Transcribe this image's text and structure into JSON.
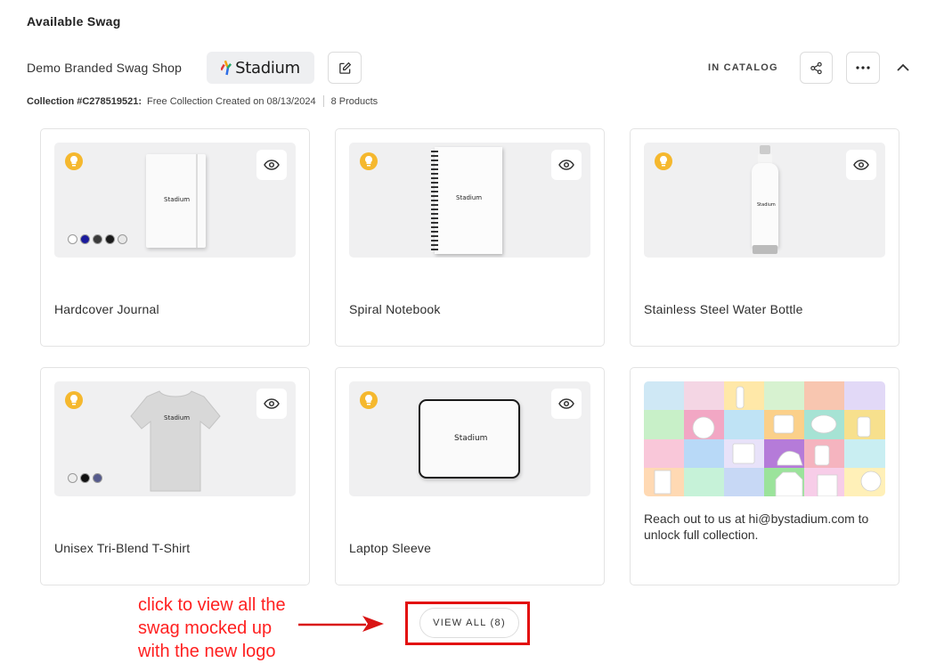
{
  "section": {
    "title": "Available Swag"
  },
  "header": {
    "shop_name": "Demo Branded Swag Shop",
    "logo_text": "Stadium",
    "status": "IN CATALOG"
  },
  "meta": {
    "collection_label": "Collection #C278519521:",
    "created": "Free Collection Created on 08/13/2024",
    "products": "8 Products"
  },
  "products": [
    {
      "name": "Hardcover Journal",
      "item_logo": "Stadium",
      "swatches": [
        "#ffffff",
        "#1a1a9c",
        "#3a3a3a",
        "#1a1a1a",
        "#e8e8e8"
      ]
    },
    {
      "name": "Spiral Notebook",
      "item_logo": "Stadium",
      "swatches": []
    },
    {
      "name": "Stainless Steel Water Bottle",
      "item_logo": "Stadium",
      "swatches": []
    },
    {
      "name": "Unisex Tri-Blend T-Shirt",
      "item_logo": "Stadium",
      "swatches": [
        "#eeeeee",
        "#111111",
        "#555a8c"
      ]
    },
    {
      "name": "Laptop Sleeve",
      "item_logo": "Stadium",
      "swatches": []
    }
  ],
  "promo": {
    "text": "Reach out to us at hi@bystadium.com to unlock full collection."
  },
  "view_all": {
    "label": "VIEW ALL (8)"
  },
  "annotation": {
    "line1": "click to view all the",
    "line2": "swag mocked up",
    "line3": "with the new logo"
  },
  "colors": {
    "accent_bulb": "#f5b82e",
    "annotation_red": "#e20f0f"
  },
  "icons": [
    "edit-icon",
    "share-icon",
    "more-icon",
    "chevron-up-icon",
    "eye-icon",
    "lightbulb-icon"
  ]
}
